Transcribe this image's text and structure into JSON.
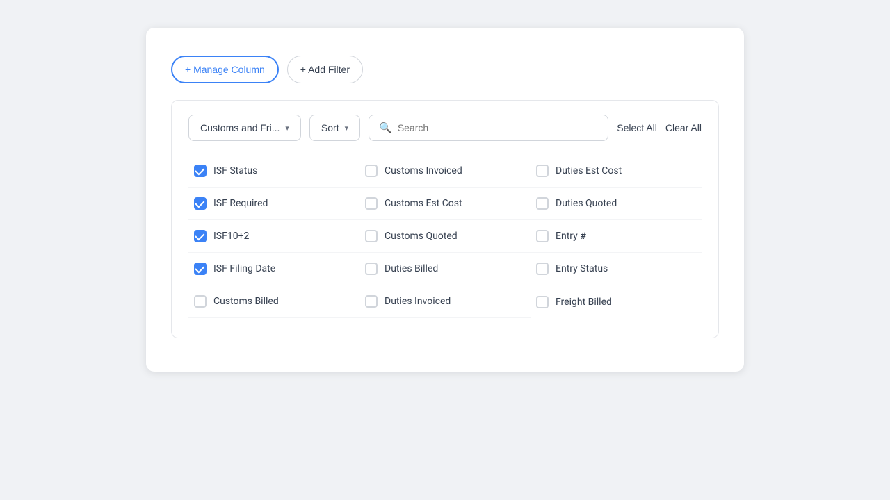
{
  "buttons": {
    "manage_column": "+ Manage Column",
    "add_filter": "+ Add Filter",
    "select_all": "Select All",
    "clear_all": "Clear All"
  },
  "filter_dropdown": {
    "label": "Customs and Fri...",
    "arrow": "▾"
  },
  "sort_dropdown": {
    "label": "Sort",
    "arrow": "▾"
  },
  "search": {
    "placeholder": "Search"
  },
  "columns": [
    {
      "id": "isf-status",
      "label": "ISF Status",
      "checked": true
    },
    {
      "id": "customs-invoiced",
      "label": "Customs Invoiced",
      "checked": false
    },
    {
      "id": "duties-est-cost",
      "label": "Duties Est Cost",
      "checked": false
    },
    {
      "id": "isf-required",
      "label": "ISF Required",
      "checked": true
    },
    {
      "id": "customs-est-cost",
      "label": "Customs Est Cost",
      "checked": false
    },
    {
      "id": "duties-quoted",
      "label": "Duties Quoted",
      "checked": false
    },
    {
      "id": "isf10-2",
      "label": "ISF10+2",
      "checked": true
    },
    {
      "id": "customs-quoted",
      "label": "Customs Quoted",
      "checked": false
    },
    {
      "id": "entry-number",
      "label": "Entry #",
      "checked": false
    },
    {
      "id": "isf-filing-date",
      "label": "ISF Filing Date",
      "checked": true
    },
    {
      "id": "duties-billed",
      "label": "Duties Billed",
      "checked": false
    },
    {
      "id": "entry-status",
      "label": "Entry Status",
      "checked": false
    },
    {
      "id": "customs-billed",
      "label": "Customs Billed",
      "checked": false
    },
    {
      "id": "duties-invoiced",
      "label": "Duties Invoiced",
      "checked": false
    },
    {
      "id": "freight-billed",
      "label": "Freight Billed",
      "checked": false
    }
  ]
}
